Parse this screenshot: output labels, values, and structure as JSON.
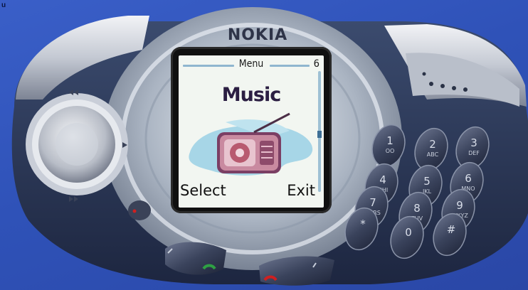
{
  "corner_text": "u",
  "phone": {
    "brand": "NOKIA",
    "screen": {
      "header_title": "Menu",
      "header_index": "6",
      "item_title": "Music",
      "item_icon": "radio-icon",
      "softkey_left": "Select",
      "softkey_right": "Exit"
    },
    "keypad": [
      {
        "digit": "1",
        "letters": "oo"
      },
      {
        "digit": "2",
        "letters": "abc"
      },
      {
        "digit": "3",
        "letters": "def"
      },
      {
        "digit": "4",
        "letters": "ghi"
      },
      {
        "digit": "5",
        "letters": "jkl"
      },
      {
        "digit": "6",
        "letters": "mno"
      },
      {
        "digit": "7",
        "letters": "pqrs"
      },
      {
        "digit": "8",
        "letters": "tuv"
      },
      {
        "digit": "9",
        "letters": "wxyz"
      },
      {
        "digit": "*",
        "letters": ""
      },
      {
        "digit": "0",
        "letters": ""
      },
      {
        "digit": "#",
        "letters": ""
      }
    ]
  },
  "colors": {
    "background": "#3458c0",
    "body_dark": "#2b3a5a",
    "body_silver": "#c7ccd6",
    "lcd_bg": "#f2f6f1",
    "accent_blue": "#8fb6cf"
  }
}
